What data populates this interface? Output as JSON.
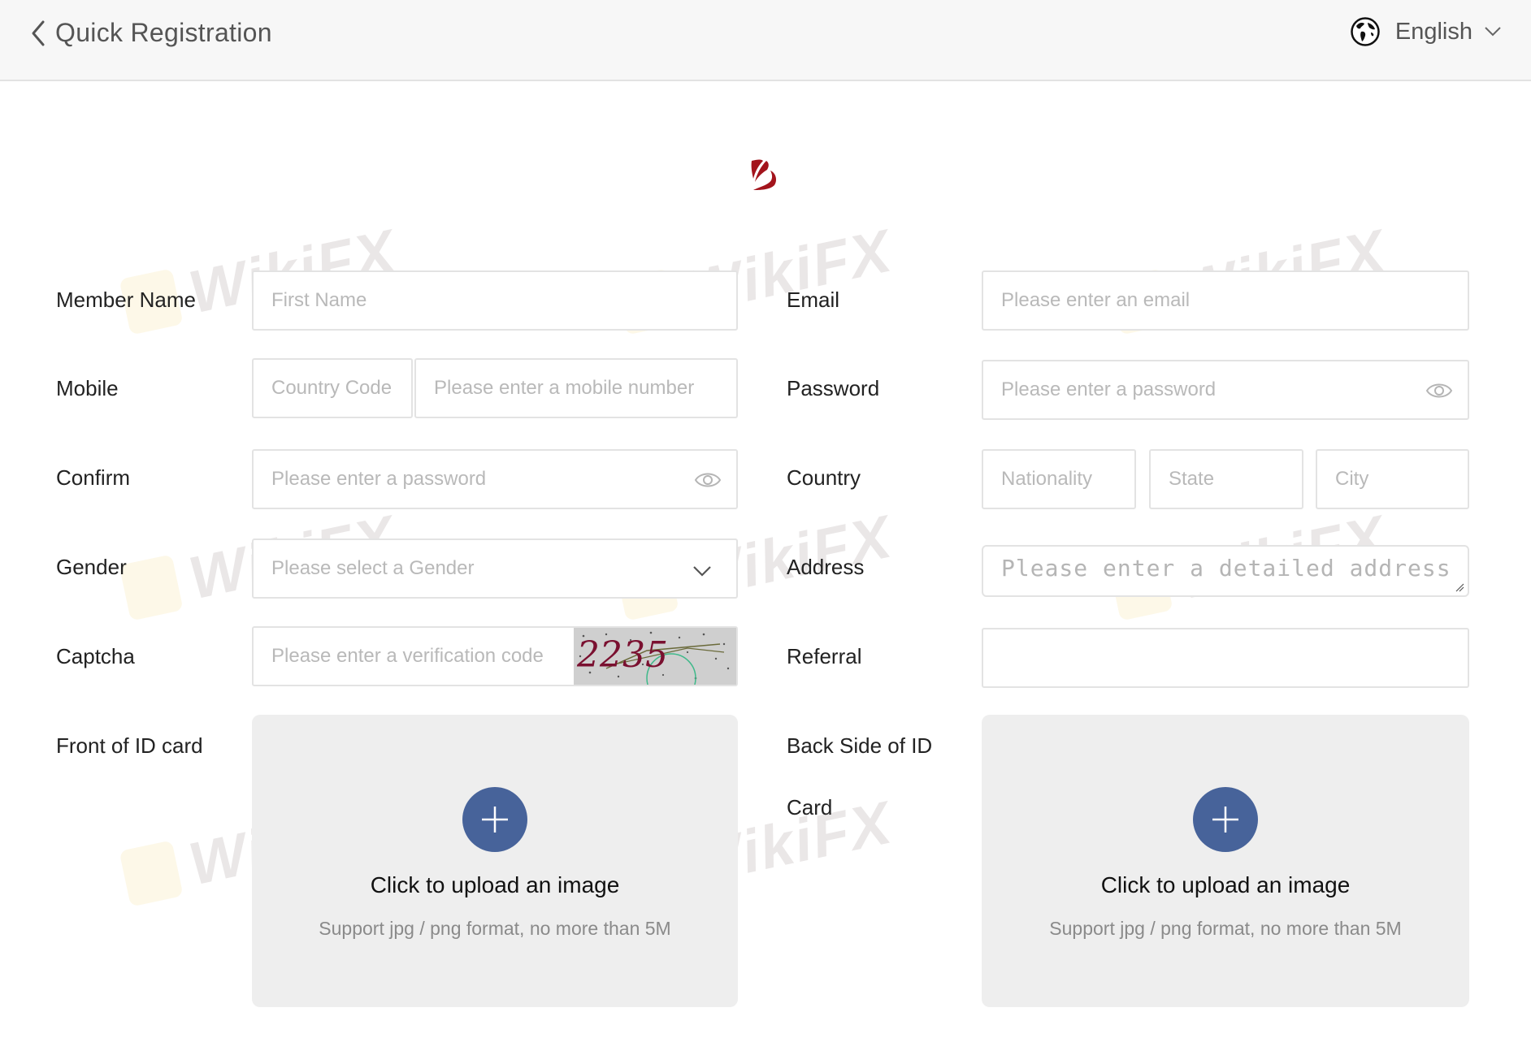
{
  "header": {
    "back_icon": "chevron-left-icon",
    "title": "Quick Registration",
    "language": {
      "icon": "globe-icon",
      "label": "English",
      "chevron": "chevron-down-icon"
    }
  },
  "logo": {
    "icon": "brand-logo-icon",
    "color": "#a3141c"
  },
  "watermark": "WikiFX",
  "form": {
    "left": {
      "member_name": {
        "label": "Member Name",
        "placeholder": "First Name",
        "value": ""
      },
      "mobile": {
        "label": "Mobile",
        "country_code_placeholder": "Country Code",
        "number_placeholder": "Please enter a mobile number"
      },
      "confirm": {
        "label": "Confirm",
        "placeholder": "Please enter a password",
        "icon": "eye-icon"
      },
      "gender": {
        "label": "Gender",
        "placeholder": "Please select a Gender",
        "icon": "chevron-down-icon"
      },
      "captcha": {
        "label": "Captcha",
        "placeholder": "Please enter a verification code",
        "captcha_text": "2235"
      },
      "front_id": {
        "label": "Front of ID card",
        "upload_title": "Click to upload an image",
        "upload_hint": "Support jpg / png format, no more than 5M",
        "icon": "plus-icon"
      }
    },
    "right": {
      "email": {
        "label": "Email",
        "placeholder": "Please enter an email",
        "value": ""
      },
      "password": {
        "label": "Password",
        "placeholder": "Please enter a password",
        "icon": "eye-icon"
      },
      "country": {
        "label": "Country",
        "nationality_placeholder": "Nationality",
        "state_placeholder": "State",
        "city_placeholder": "City"
      },
      "address": {
        "label": "Address",
        "placeholder": "Please enter a detailed address"
      },
      "referral": {
        "label": "Referral",
        "value": ""
      },
      "back_id": {
        "label_line1": "Back Side of ID",
        "label_line2": "Card",
        "upload_title": "Click to upload an image",
        "upload_hint": "Support jpg / png format, no more than 5M",
        "icon": "plus-icon"
      }
    }
  },
  "colors": {
    "accent": "#47639a",
    "header_bg": "#f7f7f7",
    "upload_bg": "#eeeeee",
    "border": "#e3e3e3"
  }
}
